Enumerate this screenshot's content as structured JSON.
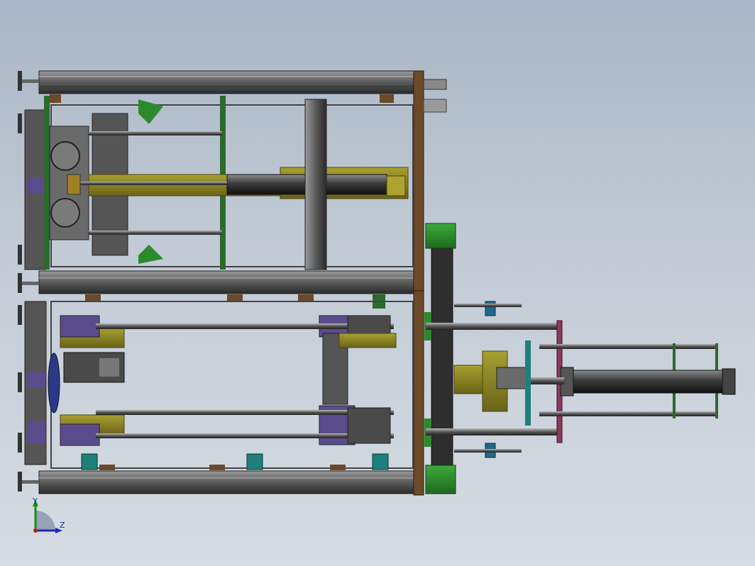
{
  "view": {
    "type": "cad-assembly-side-view",
    "background_top": "#a9b6c5",
    "background_bottom": "#d6dce3"
  },
  "colors": {
    "frame": "#6b6b6b",
    "frame_dark": "#2e2e2e",
    "plate_brown": "#6b4a2a",
    "olive": "#8a8420",
    "green": "#2c8a2c",
    "purple": "#5a4c8c",
    "teal": "#1f7f7a",
    "rod": "#5c5c5c",
    "cylinder": "#3a3a3a",
    "magenta": "#8a3a5a"
  },
  "triad": {
    "y_label": "Y",
    "z_label": "Z",
    "icon": "coordinate-triad-icon"
  }
}
